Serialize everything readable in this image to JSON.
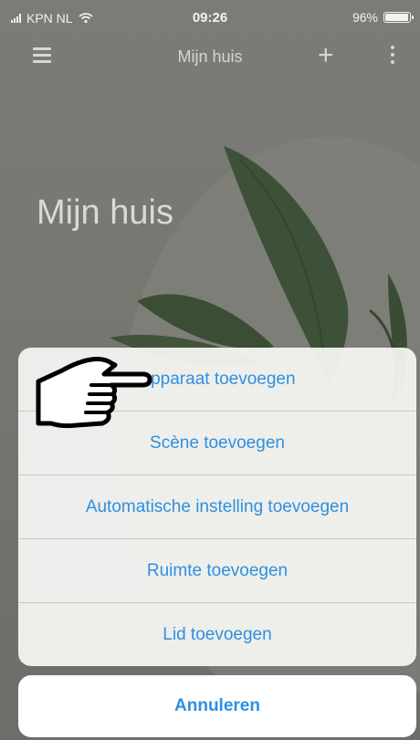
{
  "status_bar": {
    "carrier": "KPN NL",
    "time": "09:26",
    "battery": "96%"
  },
  "nav": {
    "title": "Mijn huis"
  },
  "page": {
    "heading": "Mijn huis"
  },
  "action_sheet": {
    "items": [
      {
        "label": "Apparaat toevoegen"
      },
      {
        "label": "Scène toevoegen"
      },
      {
        "label": "Automatische instelling toevoegen"
      },
      {
        "label": "Ruimte toevoegen"
      },
      {
        "label": "Lid toevoegen"
      }
    ],
    "cancel_label": "Annuleren"
  },
  "colors": {
    "accent": "#2f8fe0",
    "overlay": "#3c3c37"
  }
}
